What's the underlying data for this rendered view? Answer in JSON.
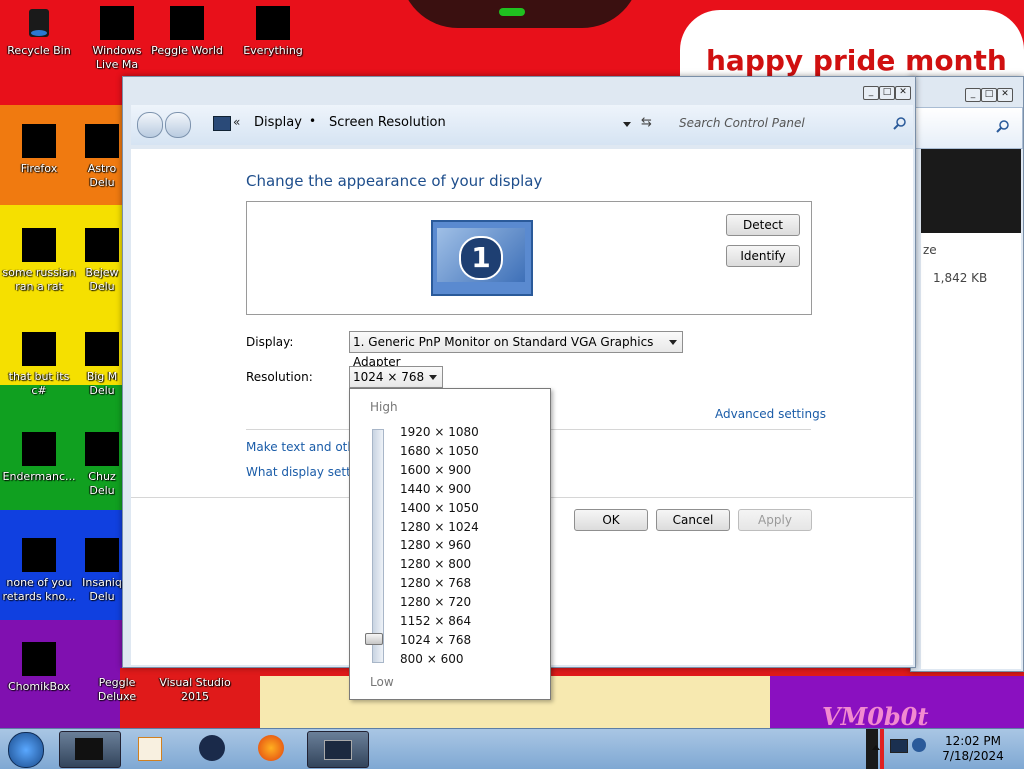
{
  "desktop": {
    "banner": "happy pride month",
    "watermark": "VM0b0t",
    "icons": [
      {
        "label": "Recycle Bin"
      },
      {
        "label": "Windows Live Ma"
      },
      {
        "label": "Peggle World"
      },
      {
        "label": "Everything"
      },
      {
        "label": "Firefox"
      },
      {
        "label": "Astro Delu"
      },
      {
        "label": "some russian ran a rat"
      },
      {
        "label": "Bejew Delu"
      },
      {
        "label": "that but its c#"
      },
      {
        "label": "Big M Delu"
      },
      {
        "label": "Endermanc..."
      },
      {
        "label": "Chuz Delu"
      },
      {
        "label": "none of you retards kno..."
      },
      {
        "label": "Insaniq Delu"
      },
      {
        "label": "ChomikBox"
      },
      {
        "label": "Peggle Deluxe"
      },
      {
        "label": "Visual Studio 2015"
      }
    ]
  },
  "bg_window": {
    "size_label": "ze",
    "file_size": "1,842 KB"
  },
  "window": {
    "title_controls": [
      "_",
      "□",
      "✕"
    ],
    "breadcrumb": {
      "root_glyph": "«",
      "item1": "Display",
      "sep": "•",
      "item2": "Screen Resolution"
    },
    "search_placeholder": "Search Control Panel",
    "heading": "Change the appearance of your display",
    "monitor_number": "1",
    "detect_label": "Detect",
    "identify_label": "Identify",
    "display_label": "Display:",
    "display_value": "1. Generic PnP Monitor on Standard VGA Graphics Adapter",
    "resolution_label": "Resolution:",
    "resolution_value": "1024 × 768",
    "advanced_link": "Advanced settings",
    "link1": "Make text and other",
    "link2": "What display setting",
    "ok_label": "OK",
    "cancel_label": "Cancel",
    "apply_label": "Apply"
  },
  "dropdown": {
    "high_label": "High",
    "low_label": "Low",
    "selected": "1024 × 768",
    "options": [
      "1920 × 1080",
      "1680 × 1050",
      "1600 × 900",
      "1440 × 900",
      "1400 × 1050",
      "1280 × 1024",
      "1280 × 960",
      "1280 × 800",
      "1280 × 768",
      "1280 × 720",
      "1152 × 864",
      "1024 × 768",
      "800 × 600"
    ]
  },
  "taskbar": {
    "time": "12:02 PM",
    "date": "7/18/2024"
  },
  "colors": {
    "link": "#1a5ca8",
    "heading": "#1e4e8c",
    "taskbar": "#8fb3da"
  }
}
